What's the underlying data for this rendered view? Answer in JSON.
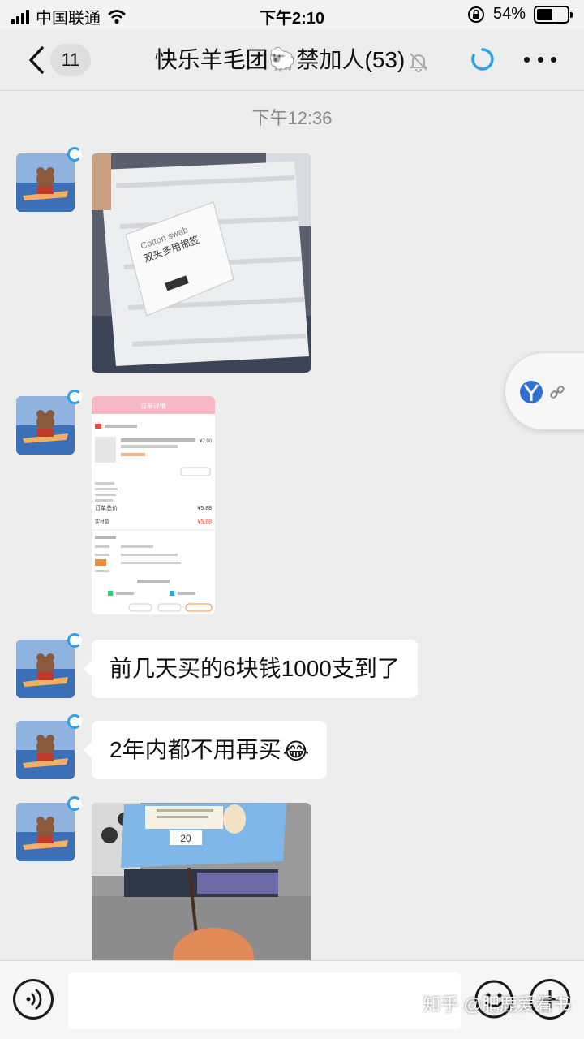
{
  "status_bar": {
    "carrier": "中国联通",
    "time": "下午2:10",
    "battery_text": "54%",
    "battery_level": 0.54,
    "icons": [
      "signal-icon",
      "wifi-icon",
      "orientation-lock-icon",
      "battery-icon"
    ]
  },
  "nav": {
    "unread_count": "11",
    "title": "快乐羊毛团🐑禁加人(53)",
    "icons": [
      "back-icon",
      "mute-bell-icon",
      "refresh-icon",
      "more-icon"
    ]
  },
  "chat": {
    "time_separator": "下午12:36",
    "messages": [
      {
        "type": "image",
        "content": "photo of cotton swab packs",
        "package_text_1": "Cotton swab",
        "package_text_2": "双头多用棉签"
      },
      {
        "type": "image",
        "content": "order screenshot",
        "order_header": "订单详情",
        "order_total": "¥5.88",
        "order_paid": "¥5.88",
        "order_item_price": "¥7.90"
      },
      {
        "type": "text",
        "text": "前几天买的6块钱1000支到了"
      },
      {
        "type": "text",
        "text": "2年内都不用再买",
        "emoji": "😂"
      },
      {
        "type": "image",
        "content": "photo of wet wipes pack",
        "pack_text": "20"
      }
    ]
  },
  "floating": {
    "icon": "link-icon"
  },
  "input_bar": {
    "placeholder": "",
    "icons": [
      "voice-icon",
      "emoji-icon",
      "plus-icon"
    ]
  },
  "watermark": "知乎 @肥鹿爱看书",
  "colors": {
    "background": "#ededed",
    "bubble": "#ffffff",
    "accent": "#29a3f0"
  }
}
